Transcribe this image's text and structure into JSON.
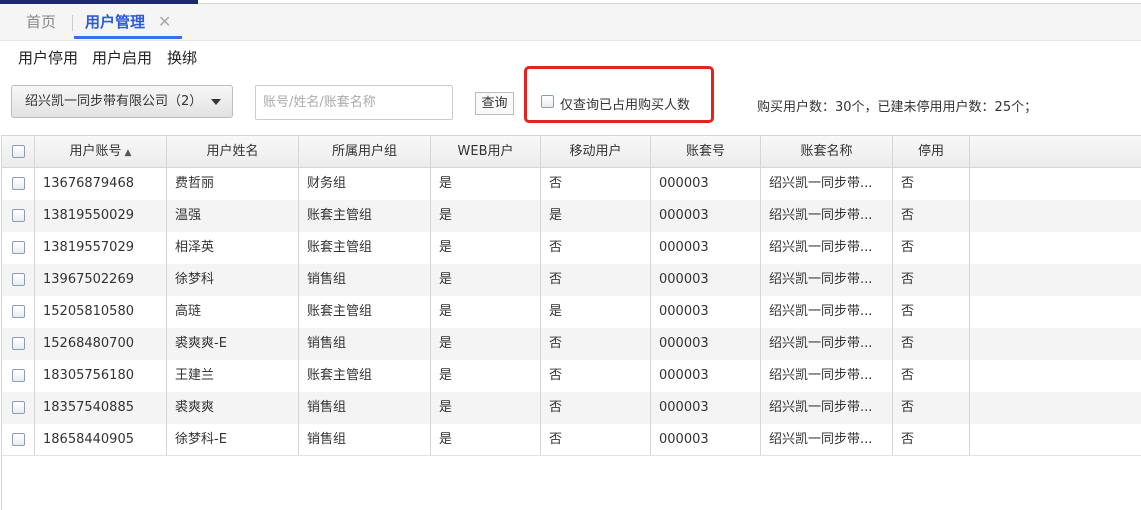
{
  "tabs": {
    "home": "首页",
    "active": "用户管理",
    "close": "✕"
  },
  "actions": [
    "用户停用",
    "用户启用",
    "换绑"
  ],
  "company_select": {
    "value": "绍兴凯一同步带有限公司（2）"
  },
  "search": {
    "placeholder": "账号/姓名/账套名称",
    "button": "查询"
  },
  "only_query_label": "仅查询已占用购买人数",
  "summary": "购买用户数：30个，已建未停用用户数：25个；",
  "table": {
    "columns": [
      "用户账号",
      "用户姓名",
      "所属用户组",
      "WEB用户",
      "移动用户",
      "账套号",
      "账套名称",
      "停用"
    ],
    "sort_indicator": "▲",
    "rows": [
      [
        "13676879468",
        "费哲丽",
        "财务组",
        "是",
        "否",
        "000003",
        "绍兴凯一同步带...",
        "否"
      ],
      [
        "13819550029",
        "温强",
        "账套主管组",
        "是",
        "是",
        "000003",
        "绍兴凯一同步带...",
        "否"
      ],
      [
        "13819557029",
        "相泽英",
        "账套主管组",
        "是",
        "否",
        "000003",
        "绍兴凯一同步带...",
        "否"
      ],
      [
        "13967502269",
        "徐梦科",
        "销售组",
        "是",
        "否",
        "000003",
        "绍兴凯一同步带...",
        "否"
      ],
      [
        "15205810580",
        "高琏",
        "账套主管组",
        "是",
        "是",
        "000003",
        "绍兴凯一同步带...",
        "否"
      ],
      [
        "15268480700",
        "裘爽爽-E",
        "销售组",
        "是",
        "否",
        "000003",
        "绍兴凯一同步带...",
        "否"
      ],
      [
        "18305756180",
        "王建兰",
        "账套主管组",
        "是",
        "否",
        "000003",
        "绍兴凯一同步带...",
        "否"
      ],
      [
        "18357540885",
        "裘爽爽",
        "销售组",
        "是",
        "否",
        "000003",
        "绍兴凯一同步带...",
        "否"
      ],
      [
        "18658440905",
        "徐梦科-E",
        "销售组",
        "是",
        "否",
        "000003",
        "绍兴凯一同步带...",
        "否"
      ]
    ]
  },
  "colors": {
    "accent": "#3b6ff0",
    "highlight": "#e5231d",
    "topbar": "#1c2a6b"
  }
}
